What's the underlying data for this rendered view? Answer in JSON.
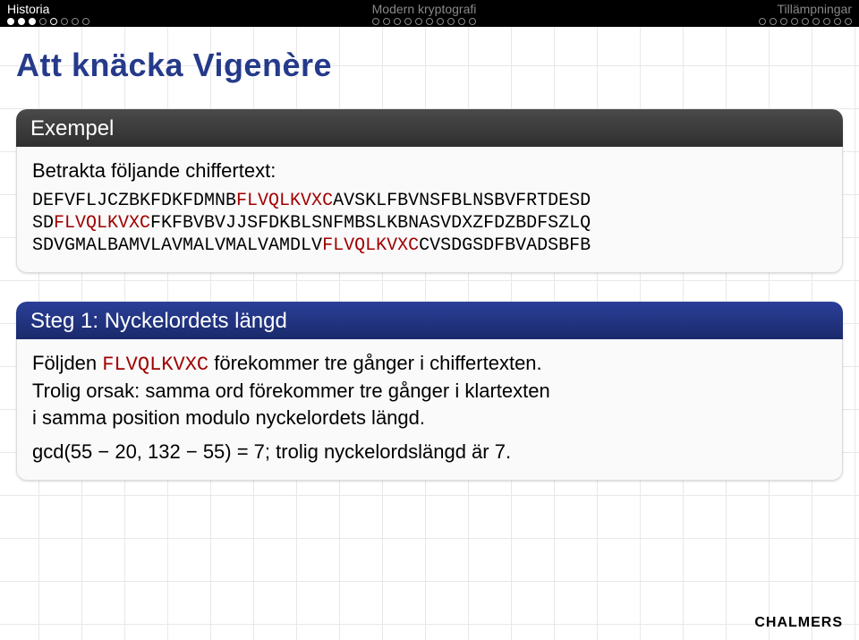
{
  "nav": {
    "left_label": "Historia",
    "center_label": "Modern kryptografi",
    "right_label": "Tillämpningar",
    "left_progress": {
      "total": 8,
      "filled": 3,
      "current": 4
    },
    "center_progress": {
      "total": 10,
      "filled": 0,
      "current": -1
    },
    "right_progress": {
      "total": 9,
      "filled": 0,
      "current": -1
    }
  },
  "title": "Att knäcka Vigenère",
  "example": {
    "header": "Exempel",
    "intro": "Betrakta följande chiffertext:",
    "cipher": {
      "p1a": "DEFVFLJCZBKFDKFDMNB",
      "p1r": "FLVQLKVXC",
      "p1b": "AVSKLFBVNSFBLNSBVFRTDESD",
      "p2a": "SD",
      "p2r": "FLVQLKVXC",
      "p2b": "FKFBVBVJJSFDKBLSNFMBSLKBNASVDXZFDZBDFSZLQ",
      "p3a": "SDVGMALBAMVLAVMALVMALVAMDLV",
      "p3r": "FLVQLKVXC",
      "p3b": "CVSDGSDFBVADSBFB"
    }
  },
  "step": {
    "header": "Steg 1: Nyckelordets längd",
    "line1_a": "Följden ",
    "seq": "FLVQLKVXC",
    "line1_b": " förekommer tre gånger i chiffertexten.",
    "line2": "Trolig orsak: samma ord förekommer tre gånger i klartexten",
    "line3": "i samma position modulo nyckelordets längd.",
    "line4": "gcd(55 − 20, 132 − 55) = 7; trolig nyckelordslängd är 7."
  },
  "footer": "CHALMERS"
}
